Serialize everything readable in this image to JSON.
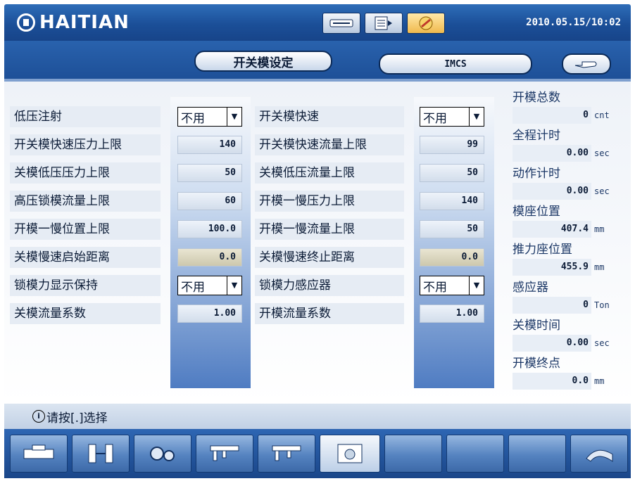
{
  "header": {
    "brand": "HAITIAN",
    "datetime": "2010.05.15/10:02",
    "icons": [
      "keyboard-icon",
      "document-icon",
      "tools-icon"
    ]
  },
  "tabs": {
    "current": "开关模设定",
    "second": "IMCS",
    "hand_icon": "hand-icon"
  },
  "params_left": [
    {
      "label": "低压注射",
      "kind": "select",
      "value": "不用"
    },
    {
      "label": "开关模快速压力上限",
      "kind": "num",
      "value": "140"
    },
    {
      "label": "关模低压压力上限",
      "kind": "num",
      "value": "50"
    },
    {
      "label": "高压锁模流量上限",
      "kind": "num",
      "value": "60"
    },
    {
      "label": "开模一慢位置上限",
      "kind": "num",
      "value": "100.0"
    },
    {
      "label": "关模慢速启始距离",
      "kind": "num",
      "value": "0.0"
    },
    {
      "label": "锁模力显示保持",
      "kind": "select",
      "value": "不用"
    },
    {
      "label": "关模流量系数",
      "kind": "num",
      "value": "1.00"
    }
  ],
  "params_right": [
    {
      "label": "开关模快速",
      "kind": "select",
      "value": "不用"
    },
    {
      "label": "开关模快速流量上限",
      "kind": "num",
      "value": "99"
    },
    {
      "label": "关模低压流量上限",
      "kind": "num",
      "value": "50"
    },
    {
      "label": "开模一慢压力上限",
      "kind": "num",
      "value": "140"
    },
    {
      "label": "开模一慢流量上限",
      "kind": "num",
      "value": "50"
    },
    {
      "label": "关模慢速终止距离",
      "kind": "num",
      "value": "0.0"
    },
    {
      "label": "锁模力感应器",
      "kind": "select",
      "value": "不用"
    },
    {
      "label": "开模流量系数",
      "kind": "num",
      "value": "1.00"
    }
  ],
  "status": [
    {
      "label": "开模总数",
      "value": "0",
      "unit": "cnt"
    },
    {
      "label": "全程计时",
      "value": "0.00",
      "unit": "sec"
    },
    {
      "label": "动作计时",
      "value": "0.00",
      "unit": "sec"
    },
    {
      "label": "模座位置",
      "value": "407.4",
      "unit": "mm"
    },
    {
      "label": "推力座位置",
      "value": "455.9",
      "unit": "mm"
    },
    {
      "label": "感应器",
      "value": "0",
      "unit": "Ton"
    },
    {
      "label": "关模时间",
      "value": "0.00",
      "unit": "sec"
    },
    {
      "label": "开模终点",
      "value": "0.0",
      "unit": "mm"
    }
  ],
  "hint": "请按[.]选择",
  "toolbar_icons": [
    "mold-setup-icon",
    "clamp-icon",
    "gear-icon",
    "ejector-icon",
    "core-icon",
    "mold-settings-icon",
    "",
    "",
    "",
    "return-icon"
  ]
}
